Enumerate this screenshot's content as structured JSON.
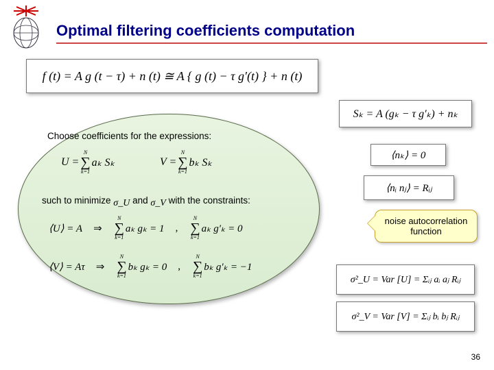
{
  "title": "Optimal filtering coefficients computation",
  "eq_main": "f (t) = A g (t − τ) + n (t) ≅ A { g (t) − τ g′(t) } + n (t)",
  "eq_sk": "Sₖ = A (gₖ − τ g′ₖ) + nₖ",
  "box": {
    "line1": "Choose coefficients for the expressions:",
    "U_expr": "U =",
    "U_sum_upper": "N",
    "U_sum_lower": "k=1",
    "U_rhs": "aₖ Sₖ",
    "V_expr": "V =",
    "V_sum_upper": "N",
    "V_sum_lower": "k=1",
    "V_rhs": "bₖ Sₖ",
    "line2_pre": "such to minimize ",
    "sigU": "σ_U",
    "line2_mid": " and ",
    "sigV": "σ_V",
    "line2_post": " with the constraints:",
    "row1": {
      "lhs": "⟨U⟩ = A",
      "arrow": "⇒",
      "c1_upper": "N",
      "c1_lower": "k=1",
      "c1": "aₖ gₖ = 1",
      "comma": ",",
      "c2_upper": "N",
      "c2_lower": "k=1",
      "c2": "aₖ g′ₖ = 0"
    },
    "row2": {
      "lhs": "⟨V⟩ = Aτ",
      "arrow": "⇒",
      "c1_upper": "N",
      "c1_lower": "k=1",
      "c1": "bₖ gₖ = 0",
      "comma": ",",
      "c2_upper": "N",
      "c2_lower": "k=1",
      "c2": "bₖ g′ₖ = −1"
    }
  },
  "right": {
    "nk0": "⟨nₖ⟩ = 0",
    "ninj": "⟨nᵢ nⱼ⟩ = Rᵢⱼ"
  },
  "callout": "noise autocorrelation function",
  "varU": "σ²_U = Var [U] = Σᵢⱼ aᵢ aⱼ Rᵢⱼ",
  "varV": "σ²_V = Var [V] = Σᵢⱼ bᵢ bⱼ Rᵢⱼ",
  "page": "36"
}
